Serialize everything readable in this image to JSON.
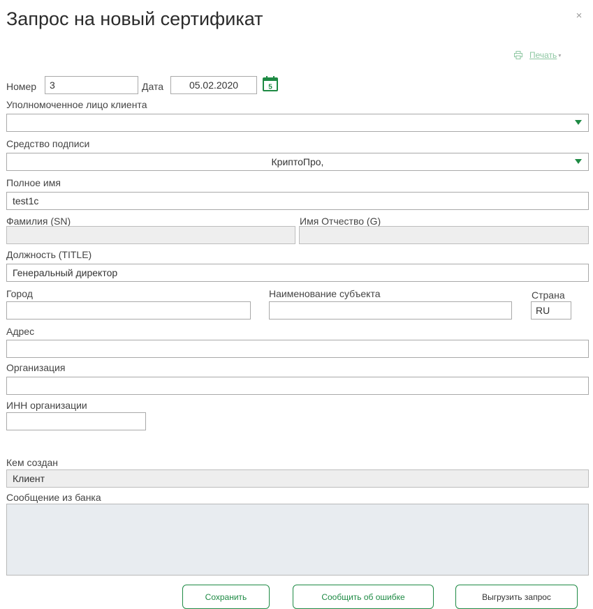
{
  "dialog": {
    "title": "Запрос на новый сертификат",
    "close_glyph": "×",
    "print_label": "Печать",
    "print_caret": "▾"
  },
  "icons": {
    "close": "close-icon",
    "print": "printer-icon",
    "calendar": "calendar-icon",
    "dropdown": "dropdown-arrow-icon"
  },
  "form": {
    "number_label": "Номер",
    "number_value": "3",
    "date_label": "Дата",
    "date_value": "05.02.2020",
    "calendar_day": "5",
    "authorized_person_label": "Уполномоченное лицо клиента",
    "authorized_person_value": "",
    "signature_tool_label": "Средство подписи",
    "signature_tool_value": "КриптоПро,",
    "full_name_label": "Полное имя",
    "full_name_value": "test1c",
    "surname_label": "Фамилия (SN)",
    "surname_value": "",
    "given_name_label": "Имя Отчество (G)",
    "given_name_value": "",
    "title_label": "Должность (TITLE)",
    "title_value": "Генеральный директор",
    "city_label": "Город",
    "city_value": "",
    "subject_label": "Наименование субъекта",
    "subject_value": "",
    "country_label": "Страна",
    "country_value": "RU",
    "address_label": "Адрес",
    "address_value": "",
    "organization_label": "Организация",
    "organization_value": "",
    "inn_label": "ИНН организации",
    "inn_value": "",
    "created_by_label": "Кем создан",
    "created_by_value": "Клиент",
    "bank_message_label": "Сообщение из банка",
    "bank_message_value": ""
  },
  "buttons": {
    "save": "Сохранить",
    "report_error": "Сообщить об ошибке",
    "export_request": "Выгрузить запрос"
  },
  "colors": {
    "accent": "#1e8a44",
    "accent_light": "#8ec7a2",
    "readonly_bg": "#eeeeee",
    "message_bg": "#e8ecf0"
  }
}
